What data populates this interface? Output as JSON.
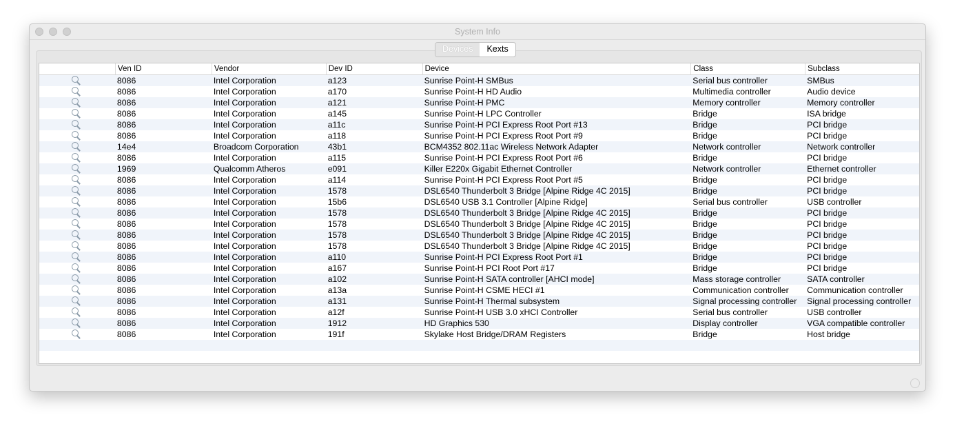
{
  "window": {
    "title": "System Info"
  },
  "tabs": [
    {
      "label": "Devices",
      "selected": false
    },
    {
      "label": "Kexts",
      "selected": true
    }
  ],
  "columns": [
    "",
    "Ven ID",
    "Vendor",
    "Dev ID",
    "Device",
    "Class",
    "Subclass"
  ],
  "rows": [
    [
      "8086",
      "Intel Corporation",
      "a123",
      "Sunrise Point-H SMBus",
      "Serial bus controller",
      "SMBus"
    ],
    [
      "8086",
      "Intel Corporation",
      "a170",
      "Sunrise Point-H HD Audio",
      "Multimedia controller",
      "Audio device"
    ],
    [
      "8086",
      "Intel Corporation",
      "a121",
      "Sunrise Point-H PMC",
      "Memory controller",
      "Memory controller"
    ],
    [
      "8086",
      "Intel Corporation",
      "a145",
      "Sunrise Point-H LPC Controller",
      "Bridge",
      "ISA bridge"
    ],
    [
      "8086",
      "Intel Corporation",
      "a11c",
      "Sunrise Point-H PCI Express Root Port #13",
      "Bridge",
      "PCI bridge"
    ],
    [
      "8086",
      "Intel Corporation",
      "a118",
      "Sunrise Point-H PCI Express Root Port #9",
      "Bridge",
      "PCI bridge"
    ],
    [
      "14e4",
      "Broadcom Corporation",
      "43b1",
      "BCM4352 802.11ac Wireless Network Adapter",
      "Network controller",
      "Network controller"
    ],
    [
      "8086",
      "Intel Corporation",
      "a115",
      "Sunrise Point-H PCI Express Root Port #6",
      "Bridge",
      "PCI bridge"
    ],
    [
      "1969",
      "Qualcomm Atheros",
      "e091",
      "Killer E220x Gigabit Ethernet Controller",
      "Network controller",
      "Ethernet controller"
    ],
    [
      "8086",
      "Intel Corporation",
      "a114",
      "Sunrise Point-H PCI Express Root Port #5",
      "Bridge",
      "PCI bridge"
    ],
    [
      "8086",
      "Intel Corporation",
      "1578",
      "DSL6540 Thunderbolt 3 Bridge [Alpine Ridge 4C 2015]",
      "Bridge",
      "PCI bridge"
    ],
    [
      "8086",
      "Intel Corporation",
      "15b6",
      "DSL6540 USB 3.1 Controller [Alpine Ridge]",
      "Serial bus controller",
      "USB controller"
    ],
    [
      "8086",
      "Intel Corporation",
      "1578",
      "DSL6540 Thunderbolt 3 Bridge [Alpine Ridge 4C 2015]",
      "Bridge",
      "PCI bridge"
    ],
    [
      "8086",
      "Intel Corporation",
      "1578",
      "DSL6540 Thunderbolt 3 Bridge [Alpine Ridge 4C 2015]",
      "Bridge",
      "PCI bridge"
    ],
    [
      "8086",
      "Intel Corporation",
      "1578",
      "DSL6540 Thunderbolt 3 Bridge [Alpine Ridge 4C 2015]",
      "Bridge",
      "PCI bridge"
    ],
    [
      "8086",
      "Intel Corporation",
      "1578",
      "DSL6540 Thunderbolt 3 Bridge [Alpine Ridge 4C 2015]",
      "Bridge",
      "PCI bridge"
    ],
    [
      "8086",
      "Intel Corporation",
      "a110",
      "Sunrise Point-H PCI Express Root Port #1",
      "Bridge",
      "PCI bridge"
    ],
    [
      "8086",
      "Intel Corporation",
      "a167",
      "Sunrise Point-H PCI Root Port #17",
      "Bridge",
      "PCI bridge"
    ],
    [
      "8086",
      "Intel Corporation",
      "a102",
      "Sunrise Point-H SATA controller [AHCI mode]",
      "Mass storage controller",
      "SATA controller"
    ],
    [
      "8086",
      "Intel Corporation",
      "a13a",
      "Sunrise Point-H CSME HECI #1",
      "Communication controller",
      "Communication controller"
    ],
    [
      "8086",
      "Intel Corporation",
      "a131",
      "Sunrise Point-H Thermal subsystem",
      "Signal processing controller",
      "Signal processing controller"
    ],
    [
      "8086",
      "Intel Corporation",
      "a12f",
      "Sunrise Point-H USB 3.0 xHCI Controller",
      "Serial bus controller",
      "USB controller"
    ],
    [
      "8086",
      "Intel Corporation",
      "1912",
      "HD Graphics 530",
      "Display controller",
      "VGA compatible controller"
    ],
    [
      "8086",
      "Intel Corporation",
      "191f",
      "Skylake Host Bridge/DRAM Registers",
      "Bridge",
      "Host bridge"
    ]
  ]
}
